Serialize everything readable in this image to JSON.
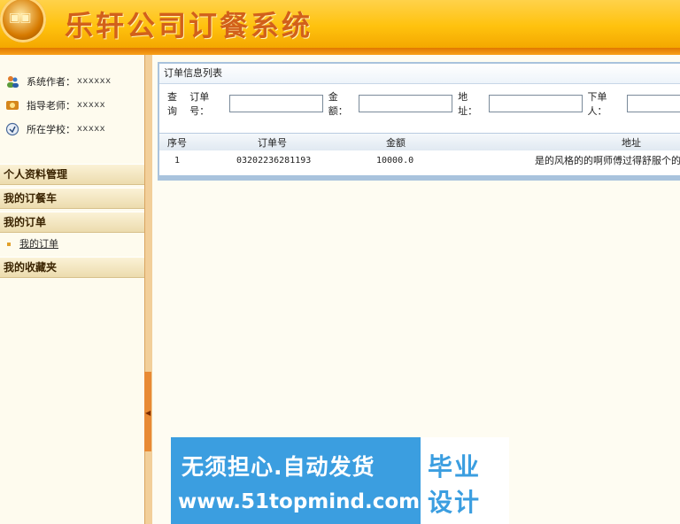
{
  "header": {
    "title": "乐轩公司订餐系统"
  },
  "sidebar": {
    "info": [
      {
        "label": "系统作者：",
        "value": "xxxxxx",
        "icon": "users-icon"
      },
      {
        "label": "指导老师：",
        "value": "xxxxx",
        "icon": "teacher-icon"
      },
      {
        "label": "所在学校：",
        "value": "xxxxx",
        "icon": "school-icon"
      }
    ],
    "menu": {
      "profile": "个人资料管理",
      "cart": "我的订餐车",
      "orders": "我的订单",
      "orders_sub": "我的订单",
      "favorites": "我的收藏夹"
    }
  },
  "panel": {
    "title": "订单信息列表",
    "search": {
      "query_label": "查询",
      "order_no_label": "订单号：",
      "amount_label": "金额：",
      "address_label": "地址：",
      "orderer_label": "下单人：",
      "order_no_value": "",
      "amount_value": "",
      "address_value": "",
      "orderer_value": ""
    },
    "table": {
      "headers": [
        "序号",
        "订单号",
        "金额",
        "地址"
      ],
      "rows": [
        [
          "1",
          "03202236281193",
          "10000.0",
          "是的风格的的啊师傅过得舒服个的"
        ]
      ]
    }
  },
  "watermark": {
    "line1": "无须担心.自动发货",
    "line2": "www.51topmind.com",
    "right_top": "毕业",
    "right_bottom": "设计"
  }
}
